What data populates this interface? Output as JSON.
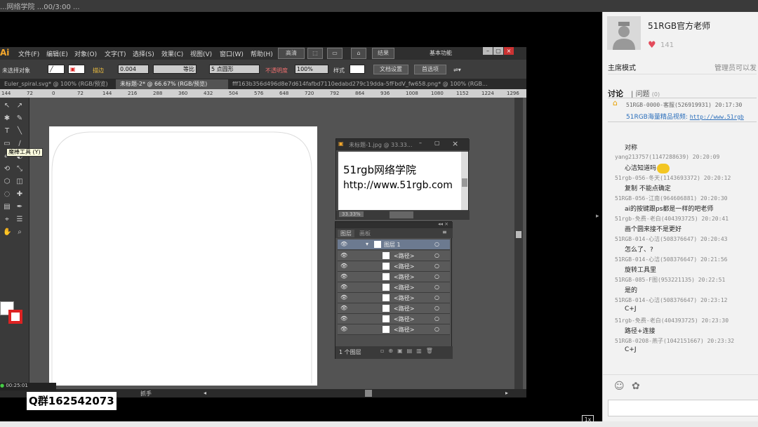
{
  "titlebar": {
    "text": "...网络学院 ...00/3:00 ..."
  },
  "illustrator": {
    "logo": "Ai",
    "menu": [
      "文件(F)",
      "编辑(E)",
      "对象(O)",
      "文字(T)",
      "选择(S)",
      "效果(C)",
      "视图(V)",
      "窗口(W)",
      "帮助(H)"
    ],
    "menu_buttons": [
      "高清",
      "结果"
    ],
    "workspace": "基本功能",
    "control": {
      "no_selection": "未选择对象",
      "stroke_label": "描边",
      "stroke_value": "0.004",
      "profile": "等比",
      "brush": "5 点圆形",
      "opacity_label": "不透明度",
      "opacity_value": "100%",
      "style_label": "样式",
      "doc_settings": "文档设置",
      "prefs": "首选项"
    },
    "tabs": [
      "Euler_spiral.svg* @ 100% (RGB/预览)",
      "未标题-2* @ 66.67% (RGB/预览)",
      "fff163b356d496d8e7d614fafbd7110edabd279c19dda-5fFbdV_fw658.png* @ 100% (RGB..."
    ],
    "ruler_ticks": [
      "144",
      "72",
      "0",
      "72",
      "144",
      "216",
      "288",
      "360",
      "432",
      "504",
      "576",
      "648",
      "720",
      "792",
      "864",
      "936",
      "1008",
      "1080",
      "1152",
      "1224",
      "1296"
    ],
    "tooltip": "魔棒工具 (Y)",
    "status_label": "抓手",
    "image_window": {
      "title": "未标题-1.jpg @ 33.33...",
      "line1": "51rgb网络学院",
      "line2": "http://www.51rgb.com",
      "zoom": "33.33%"
    },
    "layers": {
      "tabs": [
        "图层",
        "画板"
      ],
      "layer_name": "图层 1",
      "paths": [
        "<路径>",
        "<路径>",
        "<路径>",
        "<路径>",
        "<路径>",
        "<路径>",
        "<路径>",
        "<路径>"
      ],
      "footer": "1 个图层"
    },
    "playback_time": "00:25:01",
    "qq_label": "Q群162542073",
    "speed": "1x"
  },
  "sidebar": {
    "teacher": "51RGB官方老师",
    "likes": "141",
    "mode": "主席模式",
    "admin": "管理员可以发",
    "tab_discuss": "讨论",
    "tab_question": "问题",
    "question_count": "(0)",
    "pinned_meta": "51RGB-0000-客服(526919931) 20:17:30",
    "pinned_text": "51RGB海量精品视频:",
    "pinned_link": "http://www.51rgb",
    "messages": [
      {
        "meta": "",
        "text": "对称"
      },
      {
        "meta": "yang213757(1147288639) 20:20:09",
        "text": "心洁知道吗"
      },
      {
        "meta": "51rgb-056-冬天(1143693372) 20:20:12",
        "text": "复制 不能点确定"
      },
      {
        "meta": "51RGB-056-江南(964606881) 20:20:30",
        "text": "ai的按键跟ps都是一样的吧老师"
      },
      {
        "meta": "51rgb-免费-老白(404393725) 20:20:41",
        "text": "画个圆来接不是更好"
      },
      {
        "meta": "51RGB-014-心洁(508376647) 20:20:43",
        "text": "怎么了、?"
      },
      {
        "meta": "51RGB-014-心洁(508376647) 20:21:56",
        "text": "旋转工具里"
      },
      {
        "meta": "51RGB-085-F图(953221135) 20:22:51",
        "text": "是的"
      },
      {
        "meta": "51RGB-014-心洁(508376647) 20:23:12",
        "text": "C+J"
      },
      {
        "meta": "51rgb-免费-老白(404393725) 20:23:30",
        "text": "路径+连接"
      },
      {
        "meta": "51RGB-0208-燕子(1042151667) 20:23:32",
        "text": "C+J"
      }
    ]
  },
  "colors": {
    "accent_link": "#2a6ebb",
    "heart": "#e34b5b",
    "ai_orange": "#f7a92c"
  }
}
